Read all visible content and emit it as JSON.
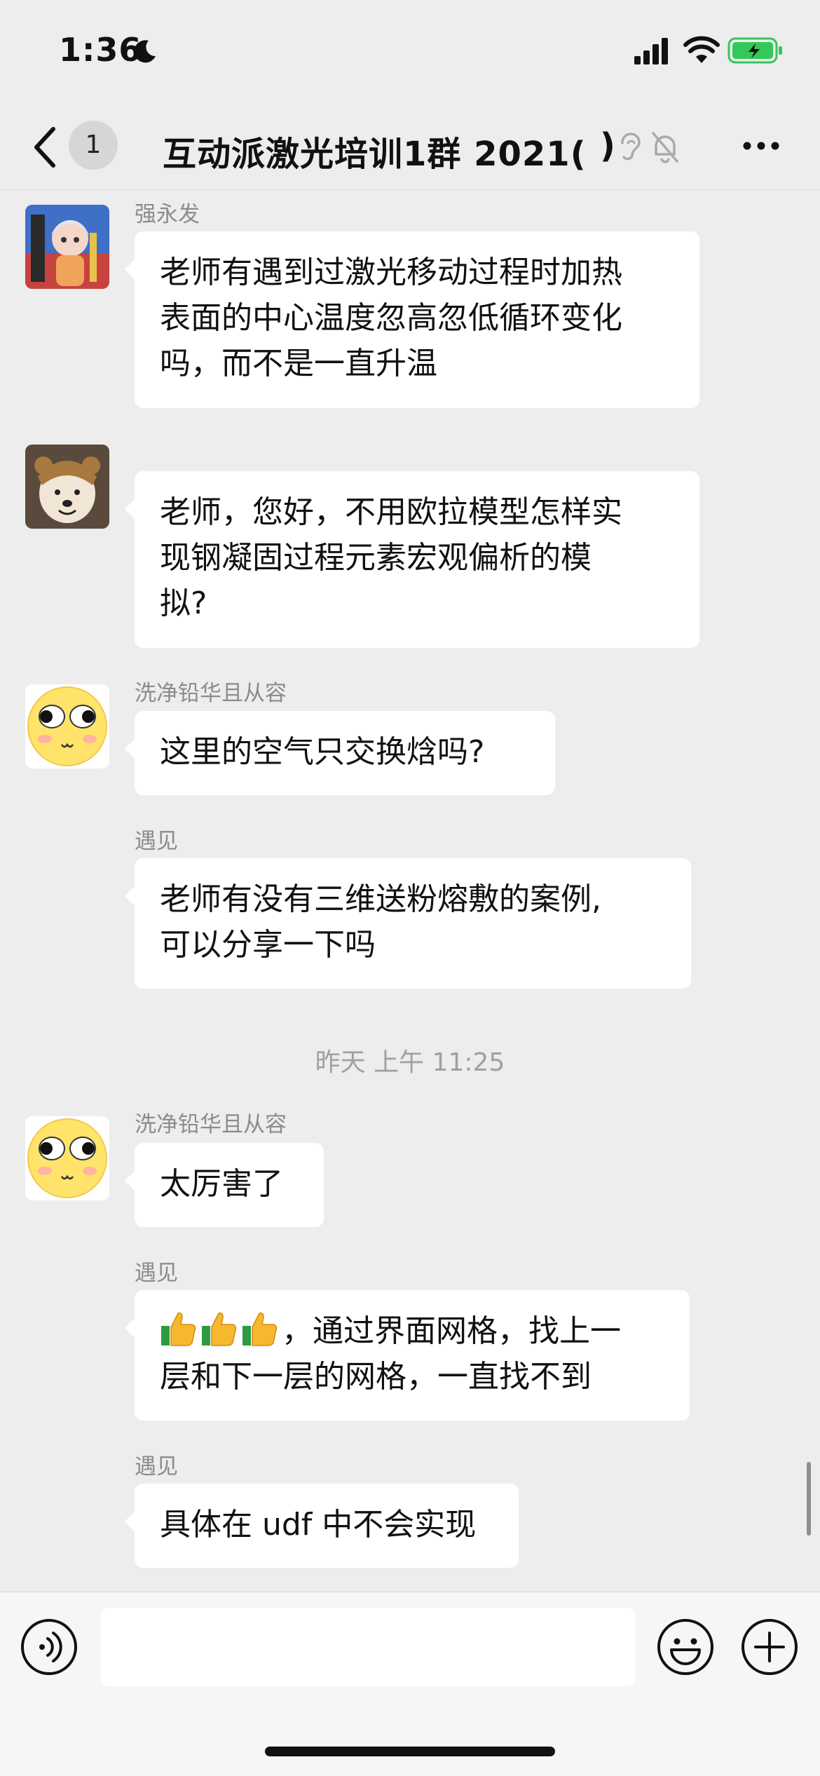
{
  "status_bar": {
    "time": "1:36"
  },
  "nav": {
    "unread_count": "1",
    "title": "互动派激光培训1群 2021(",
    "title_end": ")"
  },
  "messages": [
    {
      "sender": "强永发",
      "text": "老师有遇到过激光移动过程时加热\n表面的中心温度忽高忽低循环变化\n吗，而不是一直升温"
    },
    {
      "sender": "",
      "text": "老师，您好，不用欧拉模型怎样实\n现钢凝固过程元素宏观偏析的模\n拟?"
    },
    {
      "sender": "洗净铅华且从容",
      "text": "这里的空气只交换焓吗?"
    },
    {
      "sender": "遇见",
      "text": "老师有没有三维送粉熔敷的案例,\n可以分享一下吗"
    },
    {
      "sender": "洗净铅华且从容",
      "text": "太厉害了"
    },
    {
      "sender": "遇见",
      "text": "，通过界面网格，找上一\n层和下一层的网格，一直找不到",
      "prefix_emoji": [
        "thumbs-up",
        "thumbs-up",
        "thumbs-up"
      ]
    },
    {
      "sender": "遇见",
      "text": "具体在 udf 中不会实现"
    }
  ],
  "time_divider": "昨天 上午 11:25",
  "input": {
    "placeholder": ""
  },
  "colors": {
    "background": "#ededed",
    "bubble": "#ffffff",
    "sender_name": "#8c8c8c",
    "battery": "#34c759"
  },
  "icons": [
    "moon-icon",
    "signal-icon",
    "wifi-icon",
    "battery-icon",
    "back-icon",
    "ear-icon",
    "mute-bell-icon",
    "more-icon",
    "voice-icon",
    "emoji-icon",
    "plus-icon",
    "thumbs-up-icon"
  ]
}
